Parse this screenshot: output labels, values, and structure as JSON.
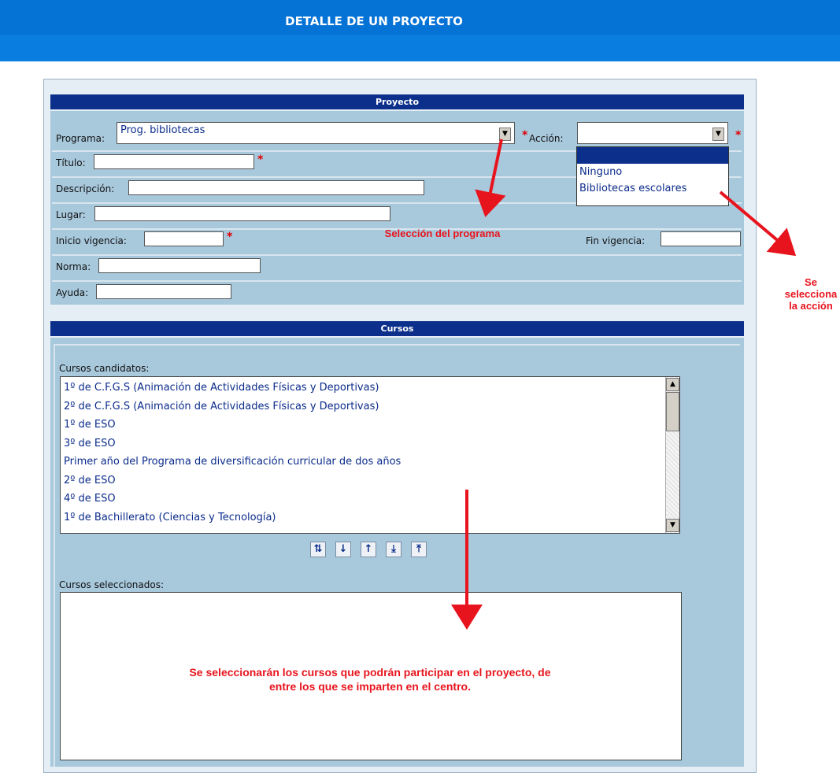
{
  "header": {
    "title": "DETALLE DE UN PROYECTO"
  },
  "proyecto": {
    "heading": "Proyecto",
    "programa_label": "Programa:",
    "programa_value": "Prog. bibliotecas",
    "accion_label": "Acción:",
    "accion_value": "",
    "accion_options": [
      "",
      "Ninguno",
      "Bibliotecas escolares"
    ],
    "titulo_label": "Título:",
    "descripcion_label": "Descripción:",
    "lugar_label": "Lugar:",
    "inicio_label": "Inicio vigencia:",
    "fin_label": "Fin vigencia:",
    "norma_label": "Norma:",
    "ayuda_label": "Ayuda:",
    "required_mark": "*"
  },
  "cursos": {
    "heading": "Cursos",
    "candidatos_label": "Cursos candidatos:",
    "candidatos": [
      "1º de C.F.G.S (Animación de Actividades Físicas y Deportivas)",
      "2º de C.F.G.S (Animación de Actividades Físicas y Deportivas)",
      "1º de ESO",
      "3º de ESO",
      "Primer año del Programa de diversificación curricular de dos años",
      "2º de ESO",
      "4º de ESO",
      "1º de Bachillerato (Ciencias y Tecnología)"
    ],
    "seleccionados_label": "Cursos seleccionados:",
    "toolbar_icons": [
      "swap-icon",
      "move-down-icon",
      "move-up-icon",
      "move-all-down-icon",
      "move-all-up-icon"
    ]
  },
  "annotations": {
    "programa_note": "Selección del programa",
    "accion_note_1": "Se",
    "accion_note_2": "selecciona",
    "accion_note_3": "la acción",
    "cursos_note_1": "Se seleccionarán los cursos que podrán participar en el proyecto, de",
    "cursos_note_2": "entre los  que se imparten en el centro."
  },
  "colors": {
    "header_blue": "#0572d6",
    "panel_head": "#0b2f8a",
    "panel_body": "#a8c8dc",
    "annotation_red": "#e8141d"
  }
}
